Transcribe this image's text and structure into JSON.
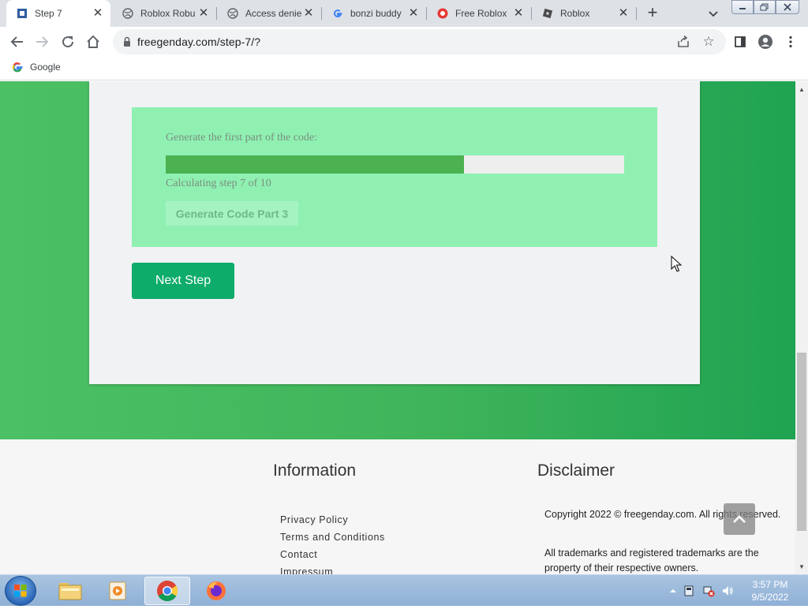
{
  "browser": {
    "tabs": [
      {
        "title": "Step 7",
        "active": true
      },
      {
        "title": "Roblox Robu",
        "active": false
      },
      {
        "title": "Access denie",
        "active": false
      },
      {
        "title": "bonzi buddy",
        "active": false
      },
      {
        "title": "Free Roblox",
        "active": false
      },
      {
        "title": "Roblox",
        "active": false
      }
    ],
    "url": "freegenday.com/step-7/?",
    "bookmarks": [
      {
        "label": "Google"
      }
    ]
  },
  "page": {
    "generator": {
      "label": "Generate the first part of the code:",
      "progress_fraction": 0.65,
      "status": "Calculating step 7 of 10",
      "button_label": "Generate Code Part 3"
    },
    "next_button": "Next Step",
    "footer": {
      "information_heading": "Information",
      "links": [
        "Privacy Policy",
        "Terms and Conditions",
        "Contact",
        "Impressum"
      ],
      "disclaimer_heading": "Disclaimer",
      "copyright": "Copyright 2022 © freegenday.com. All rights reserved.",
      "trademarks": "All trademarks and registered trademarks are the property of their respective owners."
    }
  },
  "taskbar": {
    "time": "3:57 PM",
    "date": "9/5/2022"
  },
  "colors": {
    "hero_green": "#3fb45a",
    "progress_fill": "#4bb151",
    "next_button": "#0eac6a",
    "generator_box": "#8ff0b2"
  }
}
